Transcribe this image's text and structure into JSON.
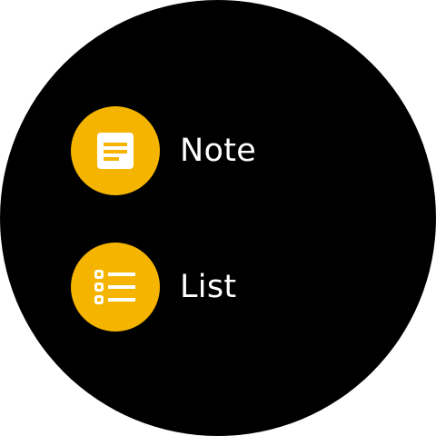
{
  "theme": {
    "background": "#000000",
    "accent": "#F4B400",
    "icon_foreground": "#ffffff",
    "text": "#ffffff"
  },
  "menu": {
    "items": [
      {
        "id": "note",
        "label": "Note",
        "icon": "note-icon"
      },
      {
        "id": "list",
        "label": "List",
        "icon": "checklist-icon"
      }
    ]
  }
}
